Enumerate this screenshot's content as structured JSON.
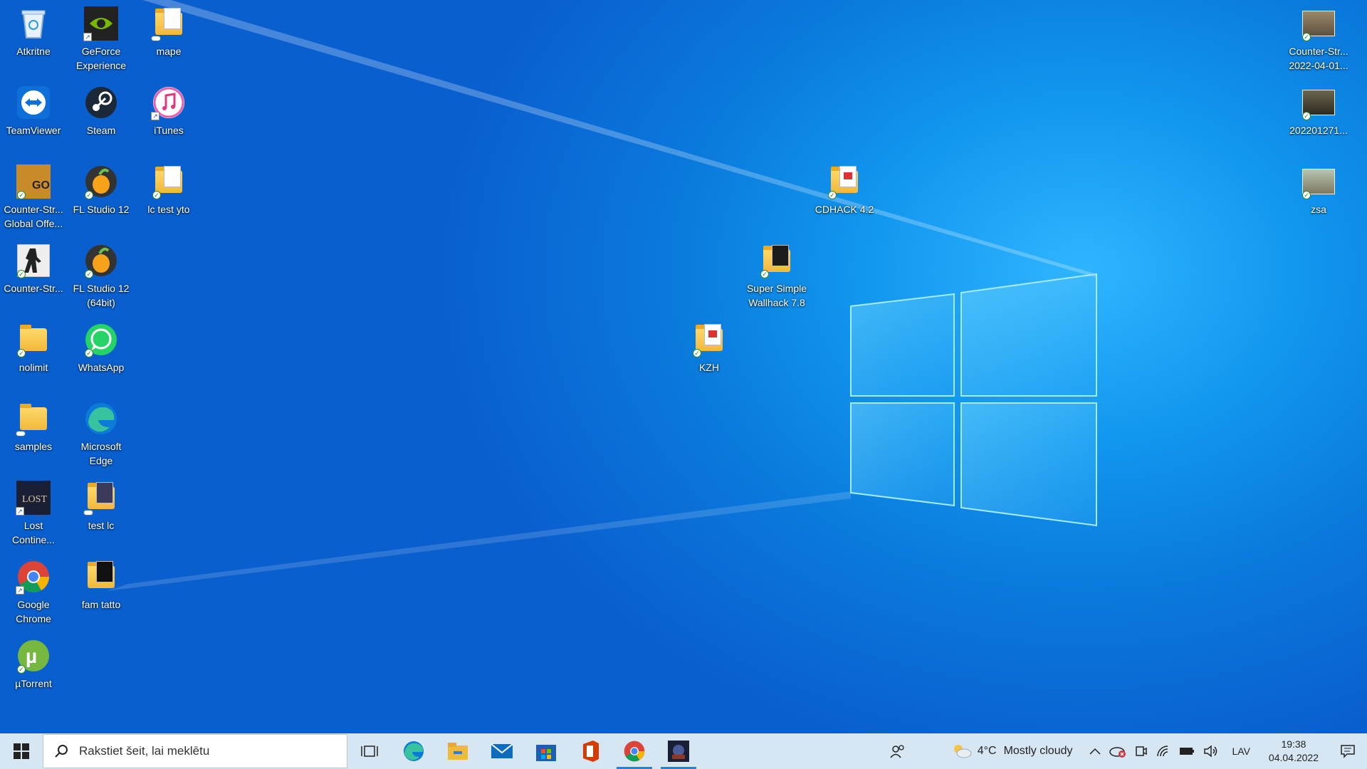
{
  "desktop_icons": [
    {
      "label": "Atkritne",
      "icon": "recycle-bin-icon"
    },
    {
      "label": "GeForce\nExperience",
      "icon": "nvidia-icon"
    },
    {
      "label": "mape",
      "icon": "folder-icon"
    },
    {
      "label": "TeamViewer",
      "icon": "teamviewer-icon"
    },
    {
      "label": "Steam",
      "icon": "steam-icon"
    },
    {
      "label": "iTunes",
      "icon": "itunes-icon"
    },
    {
      "label": "Counter-Str...\nGlobal Offe...",
      "icon": "csgo-icon"
    },
    {
      "label": "FL Studio 12",
      "icon": "fl-studio-icon"
    },
    {
      "label": "lc test yto",
      "icon": "folder-icon"
    },
    {
      "label": "Counter-Str...",
      "icon": "counter-strike-icon"
    },
    {
      "label": "FL Studio 12\n(64bit)",
      "icon": "fl-studio-icon"
    },
    {
      "label": "nolimit",
      "icon": "folder-icon"
    },
    {
      "label": "WhatsApp",
      "icon": "whatsapp-icon"
    },
    {
      "label": "samples",
      "icon": "folder-icon"
    },
    {
      "label": "Microsoft\nEdge",
      "icon": "edge-icon"
    },
    {
      "label": "Lost\nContine...",
      "icon": "lost-continent-icon"
    },
    {
      "label": "test lc",
      "icon": "folder-icon"
    },
    {
      "label": "Google\nChrome",
      "icon": "chrome-icon"
    },
    {
      "label": "fam tatto",
      "icon": "folder-icon"
    },
    {
      "label": "µTorrent",
      "icon": "utorrent-icon"
    },
    {
      "label": "CDHACK 4.2",
      "icon": "folder-icon"
    },
    {
      "label": "Super Simple\nWallhack 7.8",
      "icon": "folder-icon"
    },
    {
      "label": "KZH",
      "icon": "folder-icon"
    },
    {
      "label": "Counter-Str...\n2022-04-01...",
      "icon": "image-file-icon"
    },
    {
      "label": "202201271...",
      "icon": "image-file-icon"
    },
    {
      "label": "zsa",
      "icon": "image-file-icon"
    }
  ],
  "taskbar": {
    "search_placeholder": "Rakstiet šeit, lai meklētu",
    "apps": [
      "task-view-icon",
      "edge-icon",
      "file-explorer-icon",
      "mail-icon",
      "microsoft-store-icon",
      "office-icon",
      "chrome-icon",
      "game-icon"
    ],
    "weather": {
      "temp": "4°C",
      "condition": "Mostly cloudy"
    },
    "language": "LAV",
    "time": "19:38",
    "date": "04.04.2022"
  }
}
